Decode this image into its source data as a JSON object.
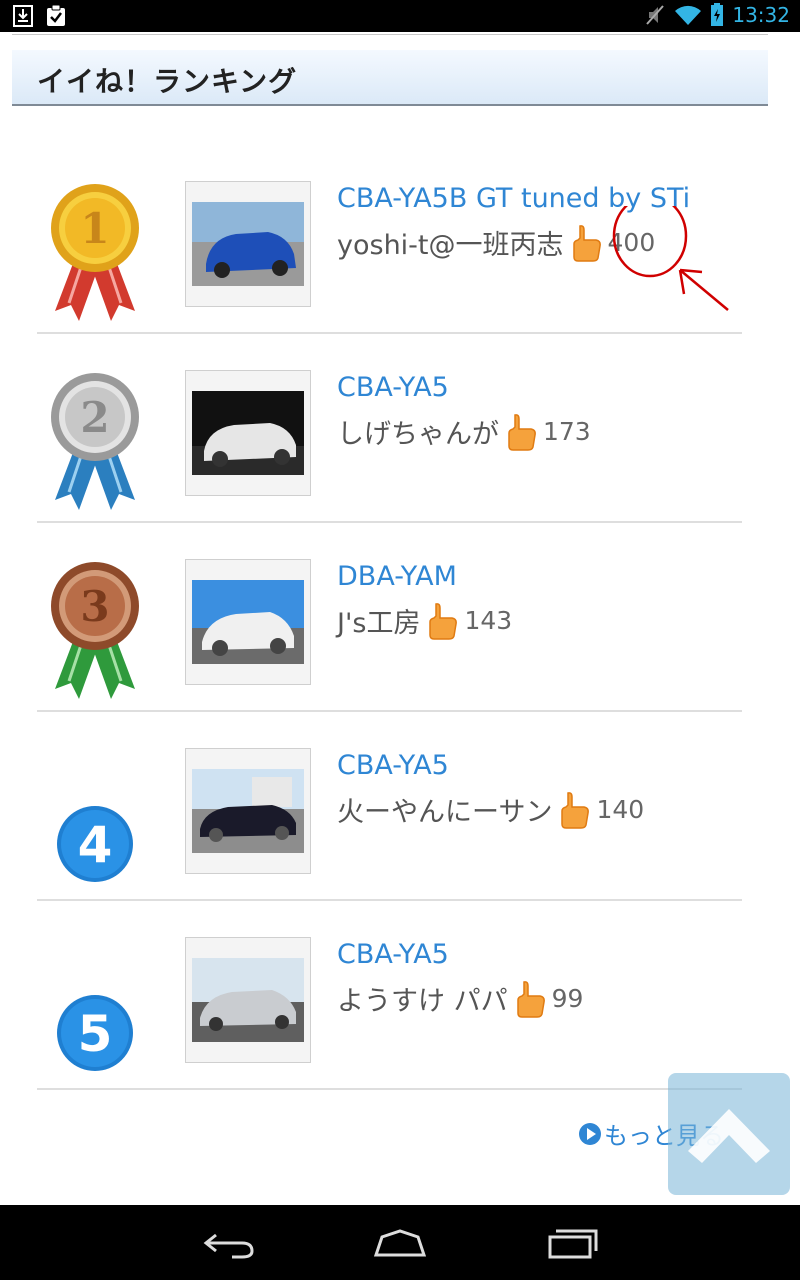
{
  "status_bar": {
    "time": "13:32",
    "left_icons": [
      "download-icon",
      "clipboard-check-icon"
    ],
    "right_icons": [
      "mute-icon",
      "wifi-icon",
      "battery-icon"
    ]
  },
  "header": {
    "title": "イイね！ランキング"
  },
  "rankings": [
    {
      "rank": 1,
      "medal": "gold",
      "title": "CBA-YA5B GT tuned by STi",
      "user": "yoshi-t@一班丙志",
      "likes": "400"
    },
    {
      "rank": 2,
      "medal": "silver",
      "title": "CBA-YA5",
      "user": "しげちゃんが",
      "likes": "173"
    },
    {
      "rank": 3,
      "medal": "bronze",
      "title": "DBA-YAM",
      "user": "J's工房",
      "likes": "143"
    },
    {
      "rank": 4,
      "medal": "blue",
      "title": "CBA-YA5",
      "user": "火ーやんにーサン",
      "likes": "140"
    },
    {
      "rank": 5,
      "medal": "blue",
      "title": "CBA-YA5",
      "user": "ようすけ パパ",
      "likes": "99"
    }
  ],
  "more": {
    "label": "もっと見る"
  },
  "colors": {
    "accent": "#2f86d4",
    "status_icons": "#33b5e5",
    "annotation": "#d00000"
  },
  "nav": {
    "buttons": [
      "back-icon",
      "home-icon",
      "recents-icon"
    ]
  }
}
